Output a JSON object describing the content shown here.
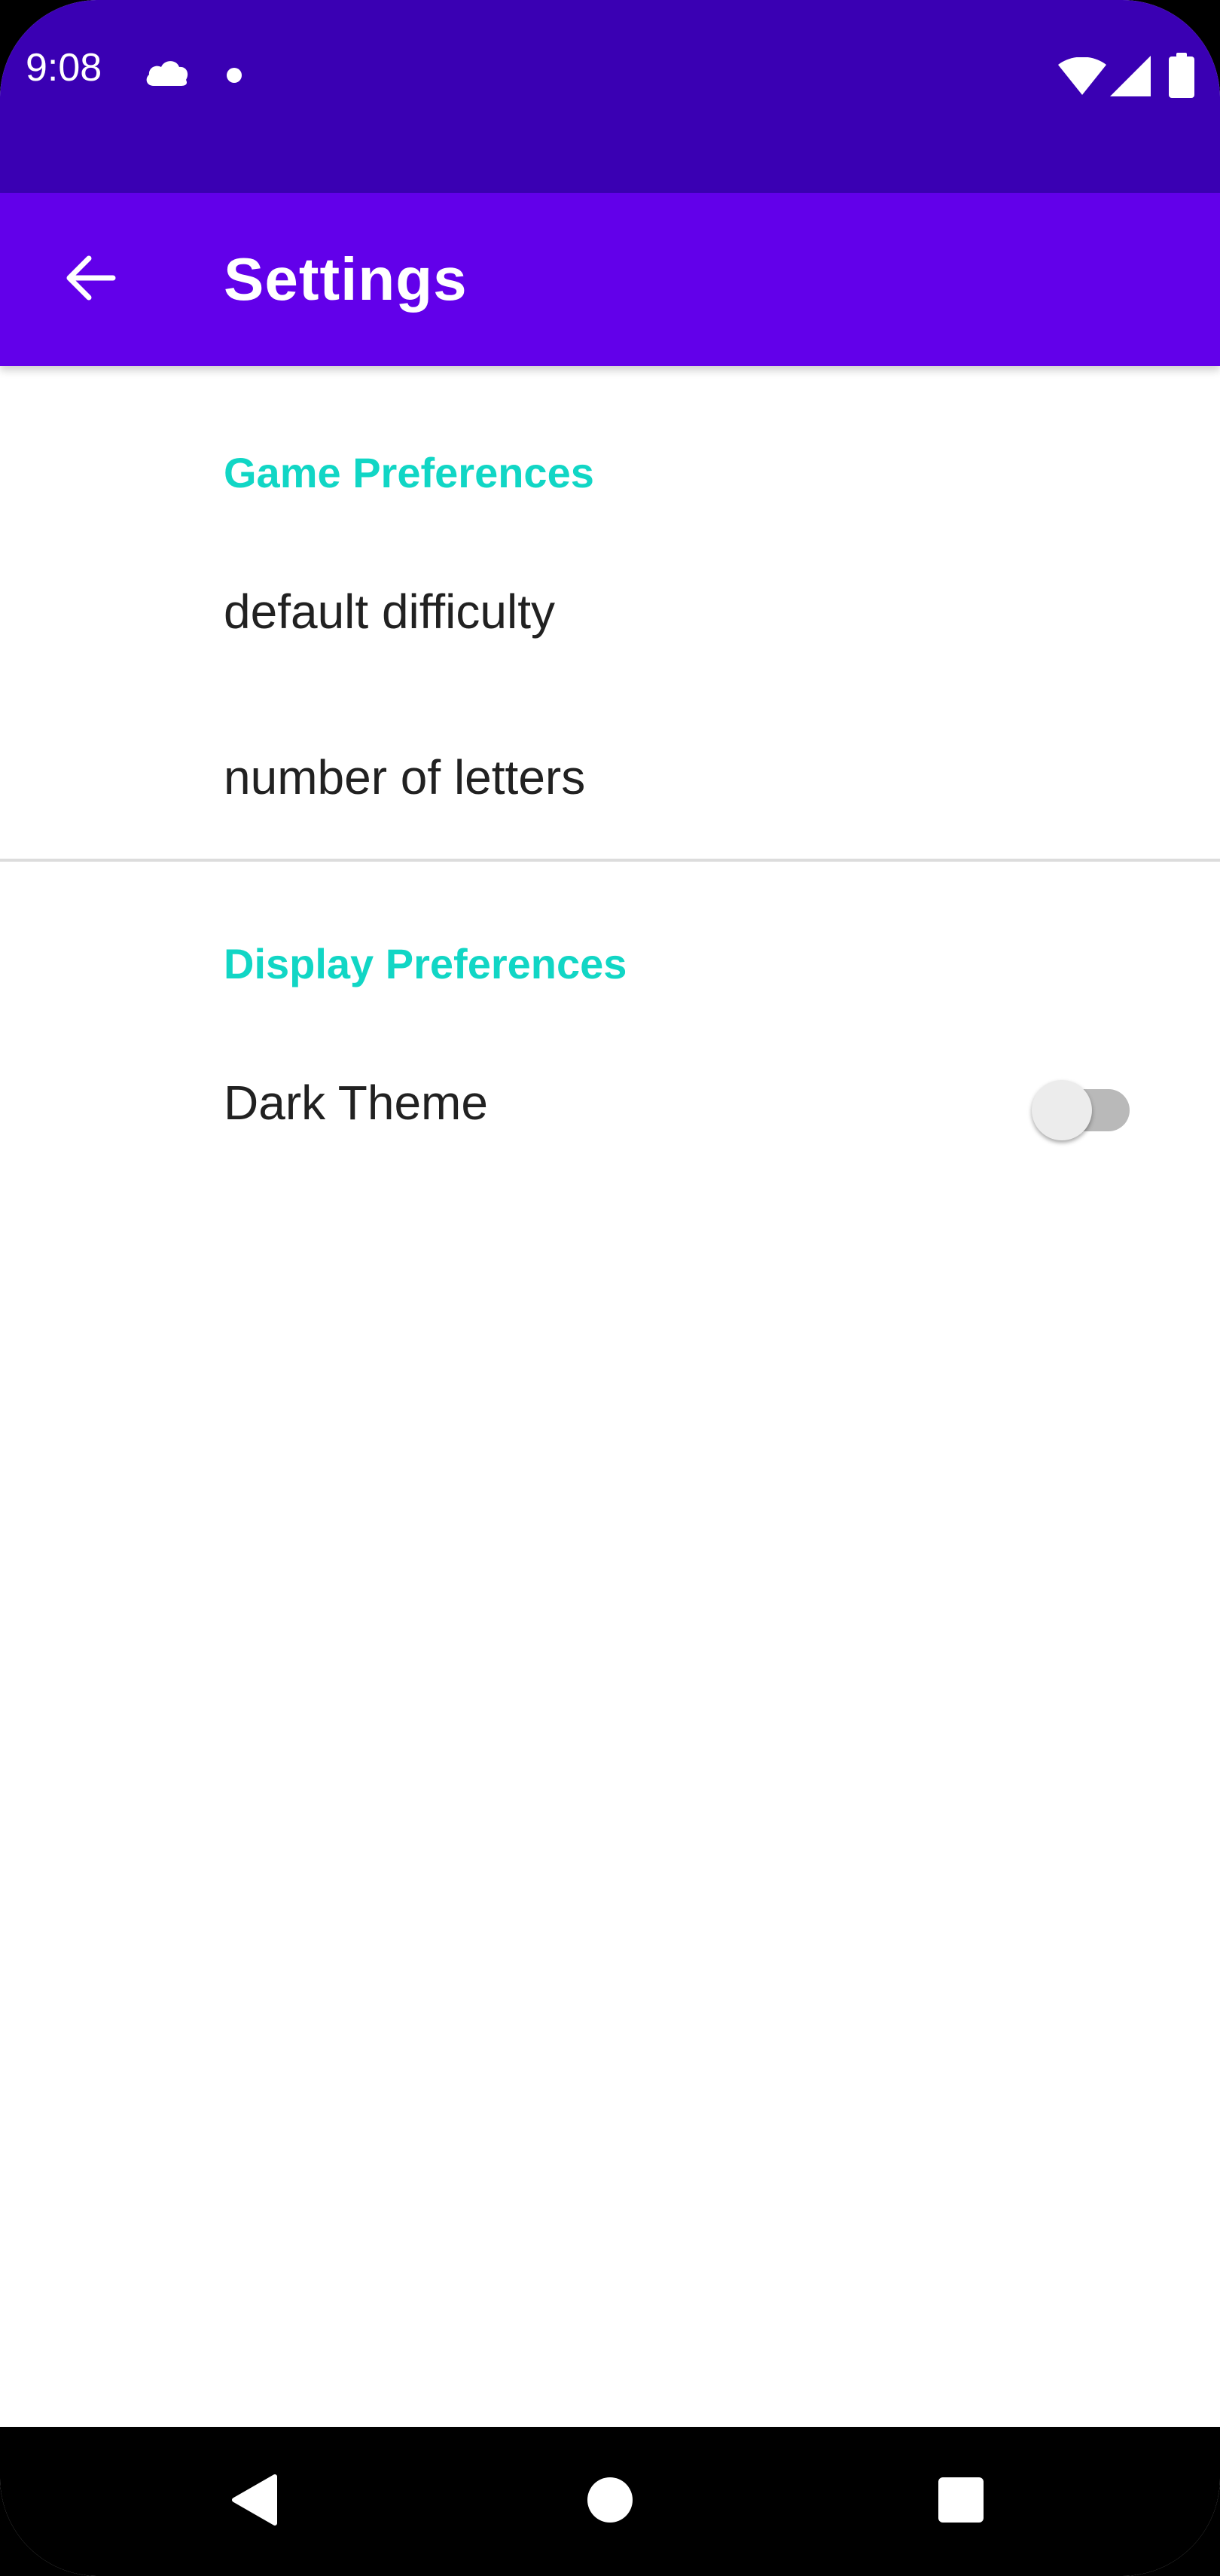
{
  "status_bar": {
    "time": "9:08",
    "icons": [
      "cloud-icon",
      "notification-dot-icon",
      "wifi-icon",
      "cellular-signal-icon",
      "battery-icon"
    ],
    "background_color": "#3a00b3"
  },
  "app_bar": {
    "title": "Settings",
    "back_icon": "arrow-left-icon",
    "background_color": "#6200ea"
  },
  "game_preferences": {
    "title": "Game Preferences",
    "items": [
      {
        "label": "default difficulty"
      },
      {
        "label": "number of letters"
      }
    ]
  },
  "display_preferences": {
    "title": "Display Preferences",
    "items": [
      {
        "label": "Dark Theme",
        "toggle_on": false
      }
    ]
  },
  "navigation_bar": {
    "buttons": [
      "back-triangle-icon",
      "home-circle-icon",
      "recents-square-icon"
    ]
  },
  "colors": {
    "category_accent": "#11d6c5",
    "text_primary": "#212121"
  }
}
